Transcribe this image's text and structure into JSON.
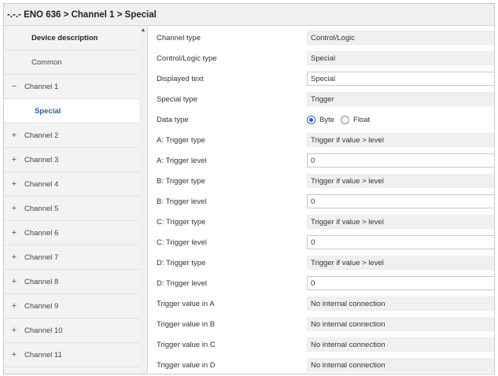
{
  "breadcrumb": "-.-.- ENO 636 > Channel 1 > Special",
  "sidebar": {
    "items": [
      {
        "sign": "",
        "label": "Device description"
      },
      {
        "sign": "",
        "label": "Common"
      },
      {
        "sign": "−",
        "label": "Channel 1"
      },
      {
        "sign": "",
        "label": "Special"
      },
      {
        "sign": "+",
        "label": "Channel 2"
      },
      {
        "sign": "+",
        "label": "Channel 3"
      },
      {
        "sign": "+",
        "label": "Channel 4"
      },
      {
        "sign": "+",
        "label": "Channel 5"
      },
      {
        "sign": "+",
        "label": "Channel 6"
      },
      {
        "sign": "+",
        "label": "Channel 7"
      },
      {
        "sign": "+",
        "label": "Channel 8"
      },
      {
        "sign": "+",
        "label": "Channel 9"
      },
      {
        "sign": "+",
        "label": "Channel 10"
      },
      {
        "sign": "+",
        "label": "Channel 11"
      }
    ],
    "selected": "Special"
  },
  "params": [
    {
      "label": "Channel type",
      "kind": "select",
      "value": "Control/Logic"
    },
    {
      "label": "Control/Logic type",
      "kind": "select",
      "value": "Special"
    },
    {
      "label": "Displayed text",
      "kind": "text",
      "value": "Special"
    },
    {
      "label": "Special type",
      "kind": "select",
      "value": "Trigger"
    },
    {
      "label": "Data type",
      "kind": "radio",
      "options": [
        "Byte",
        "Float"
      ],
      "selected": "Byte"
    },
    {
      "label": "A: Trigger type",
      "kind": "select",
      "value": "Trigger if value > level"
    },
    {
      "label": "A: Trigger level",
      "kind": "number",
      "value": "0"
    },
    {
      "label": "B: Trigger type",
      "kind": "select",
      "value": "Trigger if value > level"
    },
    {
      "label": "B: Trigger level",
      "kind": "number",
      "value": "0"
    },
    {
      "label": "C: Trigger type",
      "kind": "select",
      "value": "Trigger if value > level"
    },
    {
      "label": "C: Trigger level",
      "kind": "number",
      "value": "0"
    },
    {
      "label": "D: Trigger type",
      "kind": "select",
      "value": "Trigger if value > level"
    },
    {
      "label": "D: Trigger level",
      "kind": "number",
      "value": "0"
    },
    {
      "label": "Trigger value in A",
      "kind": "select",
      "value": "No internal connection"
    },
    {
      "label": "Trigger value in B",
      "kind": "select",
      "value": "No internal connection"
    },
    {
      "label": "Trigger value in C",
      "kind": "select",
      "value": "No internal connection"
    },
    {
      "label": "Trigger value in D",
      "kind": "select",
      "value": "No internal connection"
    }
  ],
  "icons": {
    "expand": "plus-icon",
    "collapse": "minus-icon",
    "dropdown": "chevron-down-icon",
    "spinner": "spinner-arrows-icon",
    "scroll": "scroll-up-icon"
  },
  "colors": {
    "selected_text": "#2561b0",
    "radio_accent": "#2a64c5",
    "sidebar_bg": "#f3f3f3",
    "select_bg": "#f0f0f0"
  }
}
